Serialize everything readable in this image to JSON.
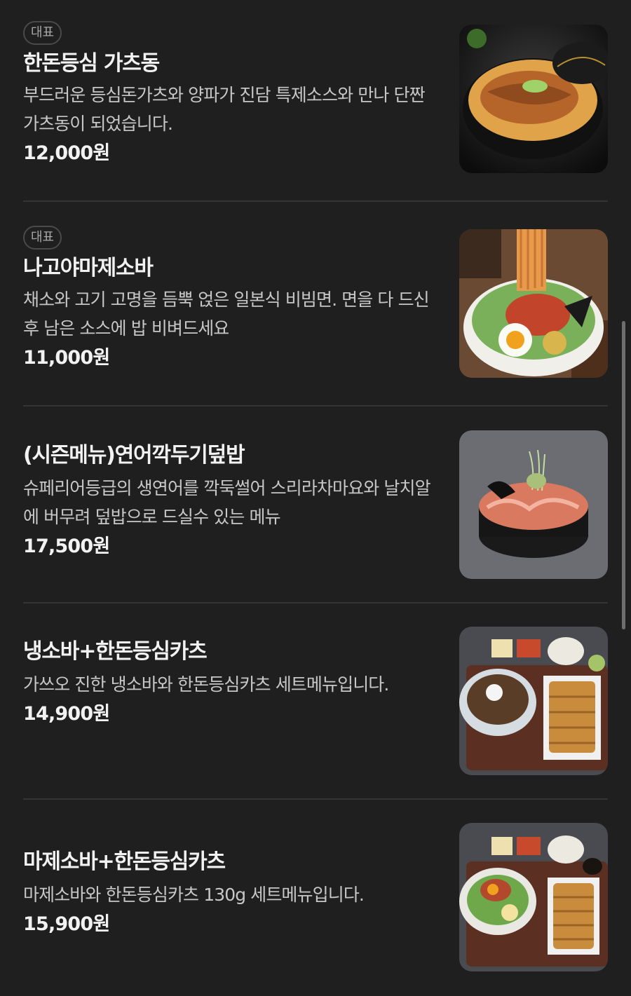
{
  "menu": {
    "badge_label": "대표",
    "items": [
      {
        "name": "한돈등심 가츠동",
        "description": "부드러운 등심돈가츠와 양파가 진담 특제소스와 만나 단짠 가츠동이 되었습니다.",
        "price": "12,000원",
        "badge": "대표",
        "image": "pork-cutlet-rice-bowl-photo"
      },
      {
        "name": "나고야마제소바",
        "description": "채소와 고기 고명을 듬뿍 얹은 일본식 비빔면. 면을 다 드신 후 남은 소스에 밥 비벼드세요",
        "price": "11,000원",
        "badge": "대표",
        "image": "mazesoba-noodle-bowl-photo"
      },
      {
        "name": "(시즌메뉴)연어깍두기덮밥",
        "description": "슈페리어등급의 생연어를 깍둑썰어 스리라차마요와 날치알에 버무려 덮밥으로 드실수 있는 메뉴",
        "price": "17,500원",
        "image": "salmon-rice-bowl-photo"
      },
      {
        "name": "냉소바+한돈등심카츠",
        "description": "가쓰오 진한 냉소바와 한돈등심카츠 세트메뉴입니다.",
        "price": "14,900원",
        "image": "cold-soba-cutlet-set-photo"
      },
      {
        "name": "마제소바+한돈등심카츠",
        "description": "마제소바와 한돈등심카츠 130g 세트메뉴입니다.",
        "price": "15,900원",
        "image": "mazesoba-cutlet-set-photo"
      }
    ]
  },
  "colors": {
    "background": "#1f1f1f",
    "text_primary": "#f2f2f2",
    "text_secondary": "#c7c7c7",
    "badge_border": "#4a4a4a",
    "divider": "#343434"
  }
}
